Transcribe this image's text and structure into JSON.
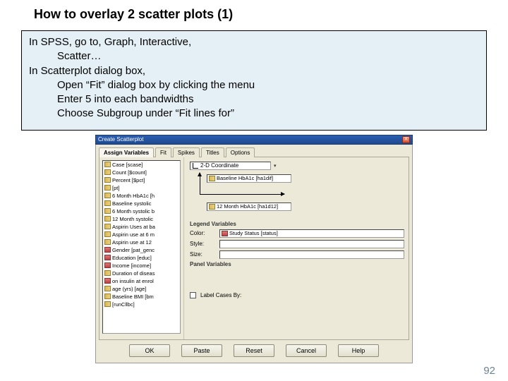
{
  "title": "How to overlay 2 scatter plots (1)",
  "note": {
    "l1": "In SPSS, go to, Graph, Interactive,",
    "l2": "Scatter…",
    "l3": "In Scatterplot dialog box,",
    "l4": "Open “Fit” dialog box by clicking the menu",
    "l5": "Enter 5 into each bandwidths",
    "l6": "Choose Subgroup under “Fit lines for”"
  },
  "dialog": {
    "window_title": "Create Scatterplot",
    "close": "X",
    "tabs": [
      "Assign Variables",
      "Fit",
      "Spikes",
      "Titles",
      "Options"
    ],
    "coord_label": "2-D Coordinate",
    "y_var": "Baseline HbA1c [ha1dif]",
    "x_var": "12 Month HbA1c [ha1d12]",
    "legend_section": "Legend Variables",
    "color_label": "Color:",
    "color_value": "Study Status [status]",
    "style_label": "Style:",
    "size_label": "Size:",
    "panel_section": "Panel Variables",
    "label_cases": "Label Cases By:",
    "buttons": {
      "ok": "OK",
      "paste": "Paste",
      "reset": "Reset",
      "cancel": "Cancel",
      "help": "Help"
    }
  },
  "vars": [
    "Case [scase]",
    "Count [$count]",
    "Percent [$pct]",
    "[pt]",
    "6 Month HbA1c [h",
    "Baseline systolic",
    "6 Month systolic b",
    "12 Month systolic",
    "Aspirin Uses at ba",
    "Aspirin use at 6 m",
    "Aspirin use at 12",
    "Gender [pat_genc",
    "Education [educ]",
    "Income [income]",
    "Duration of diseas",
    "on insulin at enrol",
    "age (yrs) [age]",
    "Baseline BMI [bm",
    "[runCllbc]"
  ],
  "page_number": "92"
}
